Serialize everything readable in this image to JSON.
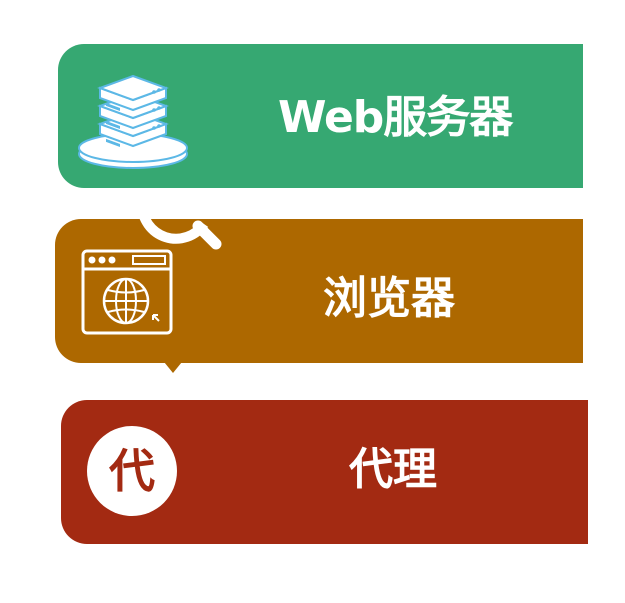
{
  "colors": {
    "green": "#36a872",
    "brown": "#ad6800",
    "red": "#a32a12",
    "white": "#ffffff",
    "server_blue": "#5cb8e6"
  },
  "items": [
    {
      "label": "Web服务器",
      "icon": "server-stack-icon"
    },
    {
      "label": "浏览器",
      "icon": "browser-window-globe-icon"
    },
    {
      "label": "代理",
      "icon": "proxy-badge-icon",
      "badge_text": "代"
    }
  ],
  "decorations": [
    "magnifier-icon",
    "down-arrow-icon"
  ]
}
